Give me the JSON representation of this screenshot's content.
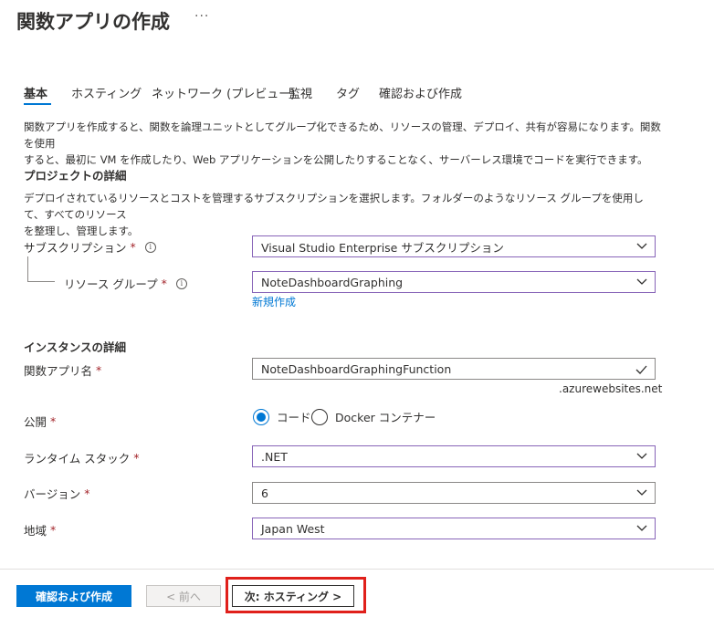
{
  "page": {
    "title": "関数アプリの作成",
    "more": "···"
  },
  "tabs": [
    {
      "label": "基本",
      "active": true
    },
    {
      "label": "ホスティング",
      "active": false
    },
    {
      "label": "ネットワーク (プレビュー)",
      "active": false
    },
    {
      "label": "監視",
      "active": false
    },
    {
      "label": "タグ",
      "active": false
    },
    {
      "label": "確認および作成",
      "active": false
    }
  ],
  "intro": {
    "line1": "関数アプリを作成すると、関数を論理ユニットとしてグループ化できるため、リソースの管理、デプロイ、共有が容易になります。関数を使用",
    "line2": "すると、最初に VM を作成したり、Web アプリケーションを公開したりすることなく、サーバーレス環境でコードを実行できます。"
  },
  "project": {
    "heading": "プロジェクトの詳細",
    "desc1": "デプロイされているリソースとコストを管理するサブスクリプションを選択します。フォルダーのようなリソース グループを使用して、すべてのリソース",
    "desc2": "を整理し、管理します。",
    "subscription_label": "サブスクリプション",
    "subscription_value": "Visual Studio Enterprise サブスクリプション",
    "resource_group_label": "リソース グループ",
    "resource_group_value": "NoteDashboardGraphing",
    "create_new": "新規作成"
  },
  "instance": {
    "heading": "インスタンスの詳細",
    "app_name_label": "関数アプリ名",
    "app_name_value": "NoteDashboardGraphingFunction",
    "app_name_suffix": ".azurewebsites.net",
    "publish_label": "公開",
    "publish_options": [
      {
        "label": "コード",
        "selected": true
      },
      {
        "label": "Docker コンテナー",
        "selected": false
      }
    ],
    "runtime_label": "ランタイム スタック",
    "runtime_value": ".NET",
    "version_label": "バージョン",
    "version_value": "6",
    "region_label": "地域",
    "region_value": "Japan West"
  },
  "common": {
    "required_mark": "*",
    "info_glyph": "i"
  },
  "footer": {
    "review_create": "確認および作成",
    "previous": "< 前へ",
    "next": "次: ホスティング >"
  },
  "colors": {
    "accent": "#0078d4",
    "focus_border": "#8764b8",
    "required": "#a4262c",
    "highlight": "#e0201b"
  }
}
